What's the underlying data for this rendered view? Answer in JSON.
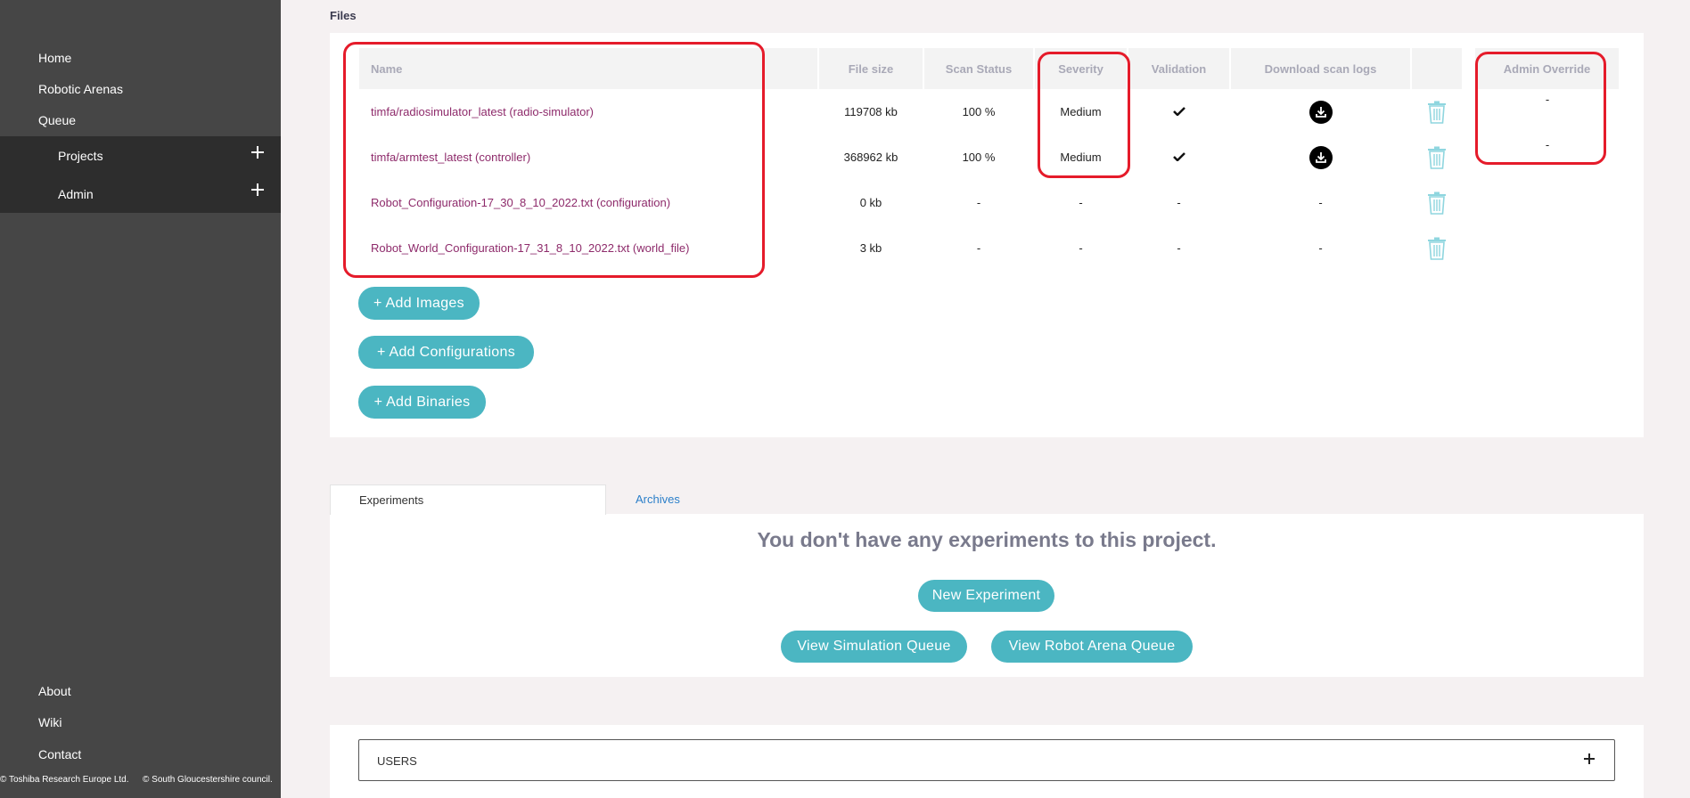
{
  "sidebar": {
    "nav": [
      {
        "label": "Home"
      },
      {
        "label": "Robotic Arenas"
      },
      {
        "label": "Queue"
      }
    ],
    "sub_items": [
      {
        "label": "Projects"
      },
      {
        "label": "Admin"
      }
    ],
    "footer_links": [
      {
        "label": "About"
      },
      {
        "label": "Wiki"
      },
      {
        "label": "Contact"
      }
    ],
    "copyright": [
      "© Toshiba Research Europe Ltd.",
      "© South Gloucestershire council."
    ]
  },
  "files": {
    "title": "Files",
    "headers": {
      "name": "Name",
      "file_size": "File size",
      "scan_status": "Scan Status",
      "severity": "Severity",
      "validation": "Validation",
      "download_scan_logs": "Download scan logs",
      "admin_override": "Admin Override"
    },
    "rows": [
      {
        "name": "timfa/radiosimulator_latest (radio-simulator)",
        "size": "119708 kb",
        "scan": "100 %",
        "severity": "Medium",
        "validation": "check",
        "download": true,
        "override": "-"
      },
      {
        "name": "timfa/armtest_latest (controller)",
        "size": "368962 kb",
        "scan": "100 %",
        "severity": "Medium",
        "validation": "check",
        "download": true,
        "override": "-"
      },
      {
        "name": "Robot_Configuration-17_30_8_10_2022.txt (configuration)",
        "size": "0 kb",
        "scan": "-",
        "severity": "-",
        "validation": "-",
        "download": false,
        "download_text": "-",
        "override": ""
      },
      {
        "name": "Robot_World_Configuration-17_31_8_10_2022.txt (world_file)",
        "size": "3 kb",
        "scan": "-",
        "severity": "-",
        "validation": "-",
        "download": false,
        "download_text": "-",
        "override": ""
      }
    ],
    "buttons": {
      "add_images": "+ Add Images",
      "add_configurations": "+ Add Configurations",
      "add_binaries": "+ Add Binaries"
    }
  },
  "experiments": {
    "tabs": {
      "active": "Experiments",
      "other": "Archives"
    },
    "empty_message": "You don't have any experiments to this project.",
    "new_button": "New Experiment",
    "sim_queue_button": "View Simulation Queue",
    "arena_queue_button": "View Robot Arena Queue"
  },
  "users": {
    "label": "USERS"
  },
  "colors": {
    "accent": "#4bb6c2",
    "link": "#8e2b6b",
    "highlight": "#e51b2a",
    "sidebar": "#464646"
  }
}
